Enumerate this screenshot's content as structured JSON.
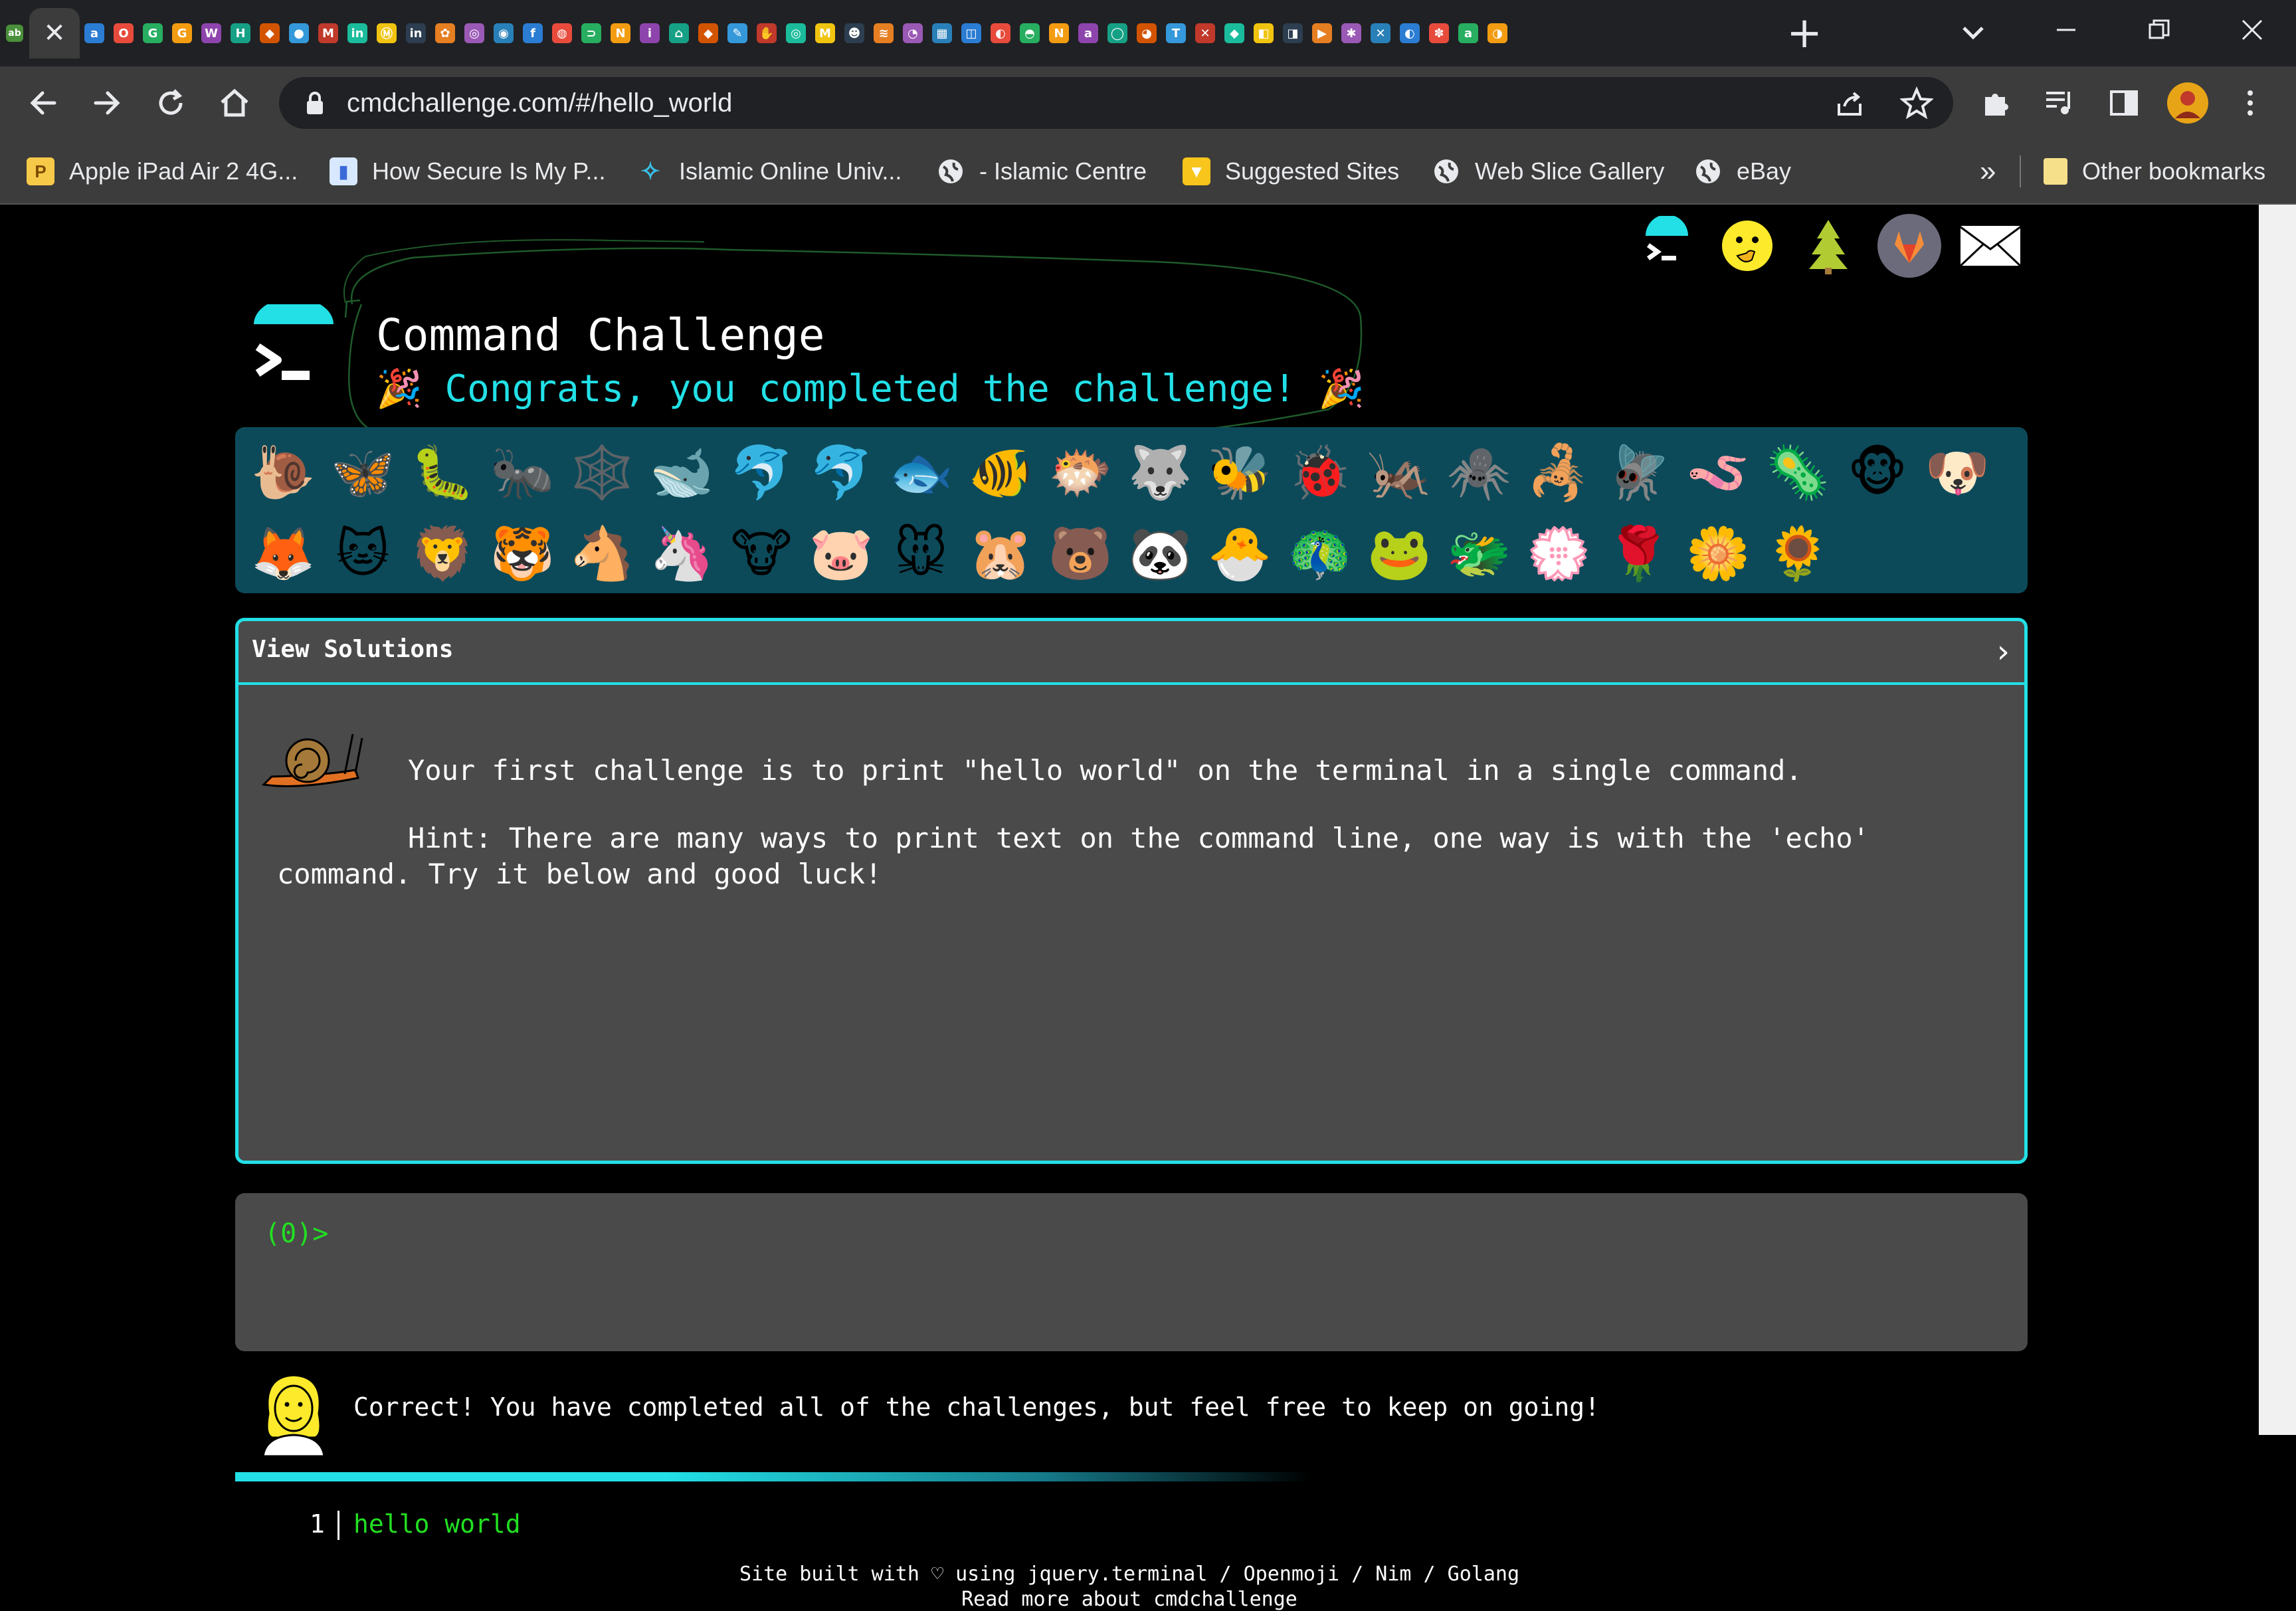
{
  "browser": {
    "url": "cmdchallenge.com/#/hello_world",
    "bookmarks": [
      {
        "label": "Apple iPad Air 2 4G...",
        "icon": "pm-icon"
      },
      {
        "label": "How Secure Is My P...",
        "icon": "lock-icon"
      },
      {
        "label": "Islamic Online Univ...",
        "icon": "star-icon"
      },
      {
        "label": "- Islamic Centre",
        "icon": "globe-icon"
      },
      {
        "label": "Suggested Sites",
        "icon": "suggested-icon"
      },
      {
        "label": "Web Slice Gallery",
        "icon": "globe-icon"
      },
      {
        "label": "eBay",
        "icon": "globe-icon"
      }
    ],
    "overflow_label": "»",
    "other_bookmarks": "Other bookmarks"
  },
  "page": {
    "title": "Command Challenge",
    "congrats": "Congrats, you completed the challenge!",
    "solutions_label": "View Solutions",
    "challenge_text": "Your first challenge is to print \"hello world\" on the terminal in a single command.",
    "hint_line1": "Hint: There are many ways to print text on the command line, one way is with the 'echo'",
    "hint_line2": "command. Try it below and good luck!",
    "prompt": "(0)>",
    "feedback": "Correct! You have completed all of the challenges, but feel free to keep on going!",
    "output_line_number": "1",
    "output_text": "hello world",
    "footer_line1": "Site built with ♡ using jquery.terminal / Openmoji / Nim / Golang",
    "footer_line2": "Read more about cmdchallenge"
  },
  "colors": {
    "accent": "#22e0e6",
    "terminal_green": "#22e022",
    "panel_bg": "#4a4a4a",
    "animal_strip_bg": "#0c4a5a"
  }
}
